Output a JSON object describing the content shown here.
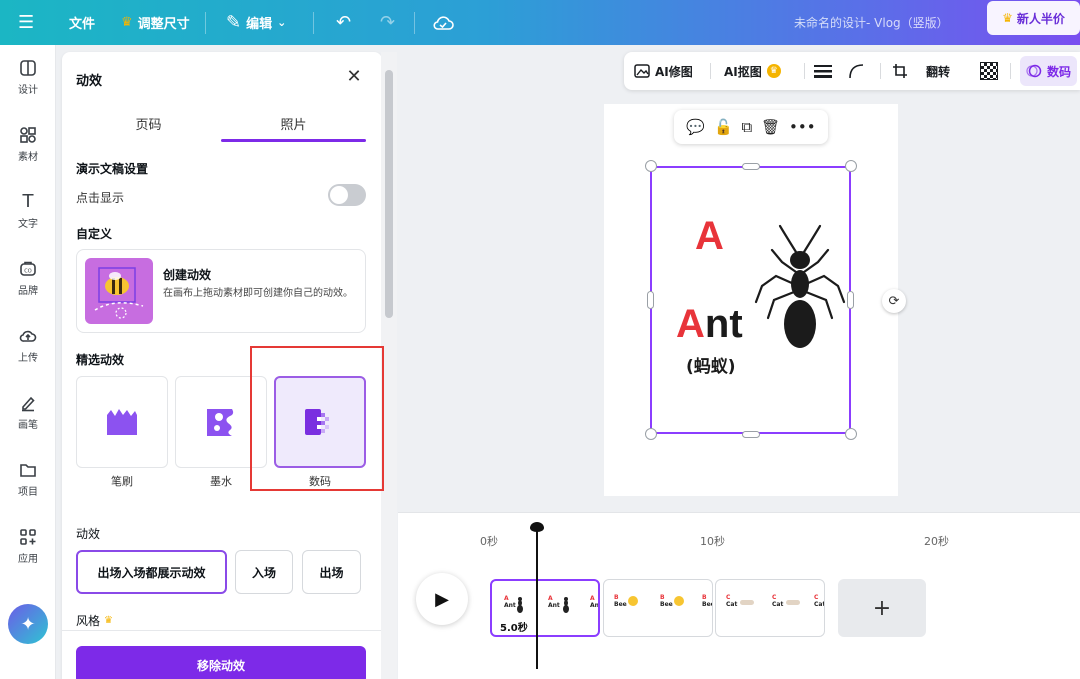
{
  "topbar": {
    "menu_icon": "hamburger-icon",
    "file": "文件",
    "resize": "调整尺寸",
    "edit": "编辑",
    "doc_title": "未命名的设计- Vlog（竖版）",
    "promo": "新人半价"
  },
  "rail": [
    {
      "label": "设计",
      "icon": "layout-icon"
    },
    {
      "label": "素材",
      "icon": "shapes-icon"
    },
    {
      "label": "文字",
      "icon": "text-icon"
    },
    {
      "label": "品牌",
      "icon": "brand-icon"
    },
    {
      "label": "上传",
      "icon": "cloud-upload-icon"
    },
    {
      "label": "画笔",
      "icon": "pen-icon"
    },
    {
      "label": "项目",
      "icon": "folder-icon"
    },
    {
      "label": "应用",
      "icon": "apps-icon"
    }
  ],
  "panel": {
    "title": "动效",
    "tabs": [
      "页码",
      "照片"
    ],
    "presentation_section": "演示文稿设置",
    "click_to_show": "点击显示",
    "custom_section": "自定义",
    "create_title": "创建动效",
    "create_desc": "在画布上拖动素材即可创建你自己的动效。",
    "featured_section": "精选动效",
    "effects": [
      "笔刷",
      "墨水",
      "数码"
    ],
    "anim_section": "动效",
    "anim_options": [
      "出场入场都展示动效",
      "入场",
      "出场"
    ],
    "style_section": "风格",
    "remove_button": "移除动效"
  },
  "toolbar": {
    "ai_edit": "AI修图",
    "ai_cutout": "AI抠图",
    "flip": "翻转",
    "digital": "数码"
  },
  "canvas": {
    "big_letter": "A",
    "word_first": "A",
    "word_rest": "nt",
    "chinese": "(蚂蚁)"
  },
  "timeline": {
    "ticks": [
      "0秒",
      "10秒",
      "20秒"
    ],
    "clip_duration": "5.0秒",
    "clips": [
      {
        "letter": "A",
        "word": "Ant"
      },
      {
        "letter": "B",
        "word": "Bee"
      },
      {
        "letter": "C",
        "word": "Cat"
      }
    ]
  },
  "colors": {
    "accent": "#7d2ae8",
    "red_letter": "#e8343a",
    "highlight": "#e53935"
  }
}
